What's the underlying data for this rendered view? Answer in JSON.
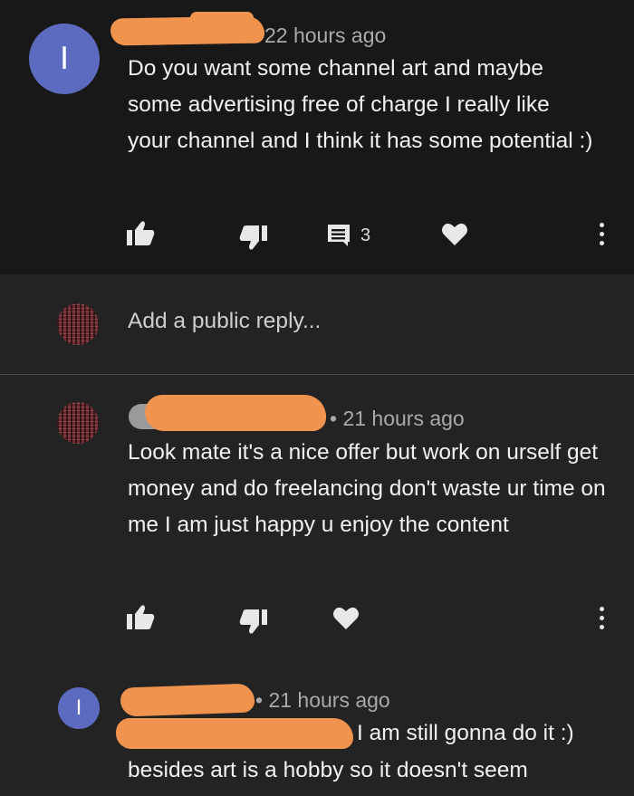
{
  "comment1": {
    "timestamp": "22 hours ago",
    "avatar_letter": "I",
    "text": "Do you want some channel art and maybe some advertising free of charge I really like your channel and I think it has some potential :)",
    "reply_count": "3"
  },
  "reply_box": {
    "placeholder": "Add a public reply..."
  },
  "reply1": {
    "timestamp": "• 21 hours ago",
    "text": "Look mate it's a nice offer but work on urself get money and do freelancing don't waste ur time on me I am just happy u enjoy the content"
  },
  "reply2": {
    "avatar_letter": "I",
    "timestamp": "• 21 hours ago",
    "text_line1": "I am still gonna do it :)",
    "text_line2": "besides art is a hobby so it doesn't seem"
  },
  "colors": {
    "background_main": "#181818",
    "background_replies": "#232323",
    "avatar_accent": "#5c6bc0",
    "redaction": "#f0934f"
  },
  "icons": [
    "like-icon",
    "dislike-icon",
    "reply-icon",
    "heart-icon",
    "more-options-icon"
  ]
}
